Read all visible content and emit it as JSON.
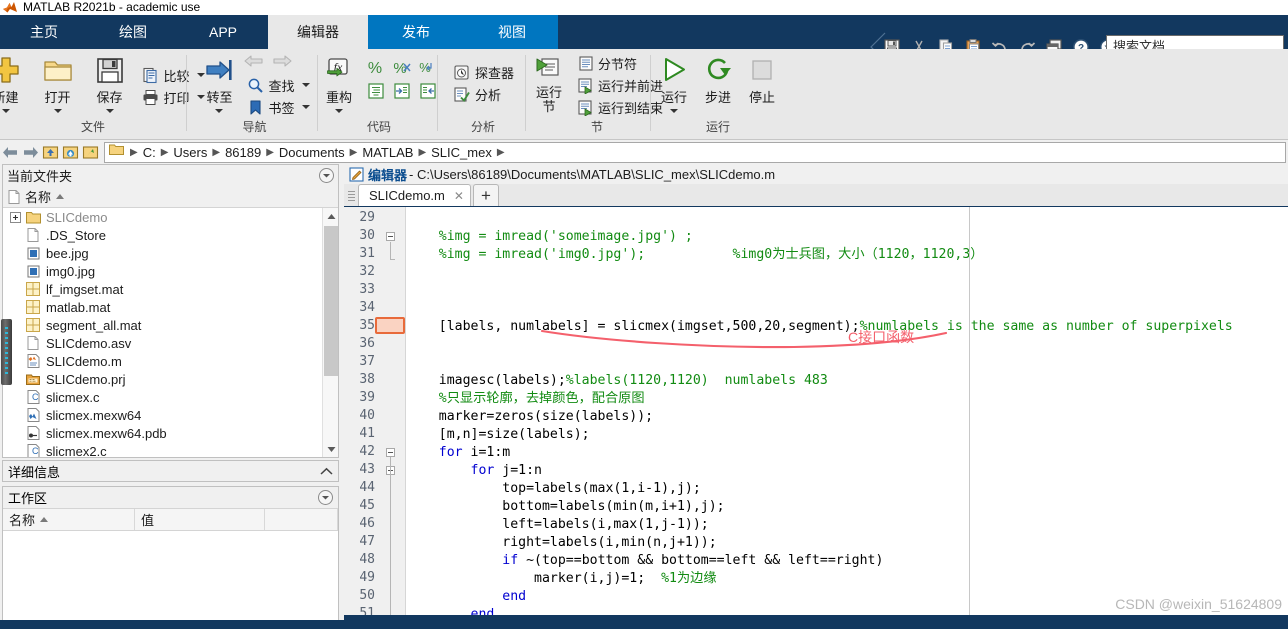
{
  "window": {
    "title": "MATLAB R2021b - academic use",
    "icon": "matlab-logo-icon"
  },
  "ribbon_tabs": [
    {
      "label": "主页",
      "active": false
    },
    {
      "label": "绘图",
      "active": false
    },
    {
      "label": "APP",
      "active": false
    },
    {
      "label": "编辑器",
      "active": true
    },
    {
      "label": "发布",
      "active": false
    },
    {
      "label": "视图",
      "active": false
    }
  ],
  "quick_access": {
    "buttons": [
      {
        "name": "save-icon",
        "label": "保存"
      },
      {
        "name": "cut-icon",
        "label": "剪切"
      },
      {
        "name": "copy-icon",
        "label": "复制"
      },
      {
        "name": "paste-icon",
        "label": "粘贴"
      },
      {
        "name": "undo-icon",
        "label": "撤销"
      },
      {
        "name": "redo-icon",
        "label": "重做"
      },
      {
        "name": "layout-icon",
        "label": "布局"
      },
      {
        "name": "help-icon",
        "label": "帮助"
      },
      {
        "name": "more-icon",
        "label": "更多"
      }
    ],
    "search_placeholder": "搜索文档"
  },
  "ribbon_groups": [
    {
      "label": "文件",
      "big_buttons": [
        {
          "label": "新建",
          "icon": "new-plus-icon",
          "has_caret": true
        },
        {
          "label": "打开",
          "icon": "open-folder-icon",
          "has_caret": true
        },
        {
          "label": "保存",
          "icon": "save-disk-icon",
          "has_caret": true
        }
      ],
      "small_buttons": [
        {
          "label": "比较",
          "icon": "compare-icon",
          "has_caret": true
        },
        {
          "label": "打印",
          "icon": "print-icon",
          "has_caret": true
        }
      ]
    },
    {
      "label": "导航",
      "big_buttons": [
        {
          "label": "转至",
          "icon": "goto-arrow-icon",
          "has_caret": true
        }
      ],
      "small_buttons": [
        {
          "label": "查找",
          "icon": "find-magnifier-icon",
          "has_caret": true
        },
        {
          "label": "书签",
          "icon": "bookmark-icon",
          "has_caret": true
        }
      ],
      "arrow_buttons": [
        {
          "name": "back-arrow-icon"
        },
        {
          "name": "forward-arrow-icon"
        }
      ]
    },
    {
      "label": "代码",
      "big_buttons": [
        {
          "label": "重构",
          "icon": "refactor-fx-icon",
          "has_caret": true
        }
      ],
      "icon_rows": [
        [
          {
            "name": "comment-percent-icon"
          },
          {
            "name": "uncomment-percent-icon"
          },
          {
            "name": "wrap-comment-icon"
          }
        ],
        [
          {
            "name": "smart-indent-icon"
          },
          {
            "name": "indent-right-icon"
          },
          {
            "name": "indent-left-icon"
          }
        ]
      ]
    },
    {
      "label": "分析",
      "small_buttons": [
        {
          "label": "探查器",
          "icon": "profiler-clock-icon",
          "has_caret": false
        },
        {
          "label": "分析",
          "icon": "analyze-check-icon",
          "has_caret": false
        }
      ]
    },
    {
      "label": "节",
      "big_buttons": [
        {
          "label1": "运行",
          "label2": "节",
          "icon": "run-section-icon",
          "has_caret": false
        }
      ],
      "small_buttons": [
        {
          "label": "分节符",
          "icon": "section-break-icon",
          "has_caret": false
        },
        {
          "label": "运行并前进",
          "icon": "run-advance-icon",
          "has_caret": false
        },
        {
          "label": "运行到结束",
          "icon": "run-to-end-icon",
          "has_caret": false
        }
      ]
    },
    {
      "label": "运行",
      "big_buttons": [
        {
          "label": "运行",
          "icon": "run-play-icon",
          "has_caret": true
        },
        {
          "label": "步进",
          "icon": "step-icon",
          "has_caret": false
        },
        {
          "label": "停止",
          "icon": "stop-icon",
          "has_caret": false
        }
      ]
    }
  ],
  "address_bar": {
    "nav_icons": [
      "back-icon",
      "forward-icon",
      "up-folder-icon",
      "home-folder-icon",
      "browse-folder-icon"
    ],
    "folder_icon": "folder-icon",
    "crumbs": [
      "C:",
      "Users",
      "86189",
      "Documents",
      "MATLAB",
      "SLIC_mex"
    ]
  },
  "current_folder": {
    "header": "当前文件夹",
    "column_header": "名称",
    "files": [
      {
        "name": "SLICdemo",
        "icon": "folder-icon",
        "expandable": true,
        "dim": true
      },
      {
        "name": ".DS_Store",
        "icon": "blank-file-icon",
        "expandable": false,
        "dim": false
      },
      {
        "name": "bee.jpg",
        "icon": "image-file-icon",
        "expandable": false,
        "dim": false
      },
      {
        "name": "img0.jpg",
        "icon": "image-file-icon",
        "expandable": false,
        "dim": false
      },
      {
        "name": "lf_imgset.mat",
        "icon": "mat-file-icon",
        "expandable": false,
        "dim": false
      },
      {
        "name": "matlab.mat",
        "icon": "mat-file-icon",
        "expandable": false,
        "dim": false
      },
      {
        "name": "segment_all.mat",
        "icon": "mat-file-icon",
        "expandable": false,
        "dim": false
      },
      {
        "name": "SLICdemo.asv",
        "icon": "blank-file-icon",
        "expandable": false,
        "dim": false
      },
      {
        "name": "SLICdemo.m",
        "icon": "m-file-icon",
        "expandable": false,
        "dim": false
      },
      {
        "name": "SLICdemo.prj",
        "icon": "prj-file-icon",
        "expandable": false,
        "dim": false
      },
      {
        "name": "slicmex.c",
        "icon": "c-file-icon",
        "expandable": false,
        "dim": false
      },
      {
        "name": "slicmex.mexw64",
        "icon": "mex-file-icon",
        "expandable": false,
        "dim": false
      },
      {
        "name": "slicmex.mexw64.pdb",
        "icon": "pdb-file-icon",
        "expandable": false,
        "dim": false
      },
      {
        "name": "slicmex2.c",
        "icon": "c-file-icon",
        "expandable": false,
        "dim": false
      }
    ]
  },
  "details_panel": {
    "header": "详细信息"
  },
  "workspace": {
    "header": "工作区",
    "columns": [
      "名称",
      "值"
    ]
  },
  "editor": {
    "title_prefix": "编辑器",
    "title_dash": " - ",
    "title_path": "C:\\Users\\86189\\Documents\\MATLAB\\SLIC_mex\\SLICdemo.m",
    "tabs": [
      {
        "label": "SLICdemo.m",
        "close": "✕"
      }
    ],
    "new_tab": "+",
    "breakpoint_line": 35,
    "lines": [
      {
        "no": 29,
        "tokens": []
      },
      {
        "no": 30,
        "fold": "open",
        "tokens": [
          {
            "t": "    ",
            "c": "p"
          },
          {
            "t": "%img = imread('someimage.jpg') ;",
            "c": "c"
          }
        ]
      },
      {
        "no": 31,
        "fold": "tail",
        "tokens": [
          {
            "t": "    ",
            "c": "p"
          },
          {
            "t": "%img = imread('img0.jpg');           %img0为士兵图，大小（1120，1120,3）",
            "c": "c"
          }
        ]
      },
      {
        "no": 32,
        "tokens": []
      },
      {
        "no": 33,
        "tokens": []
      },
      {
        "no": 34,
        "tokens": []
      },
      {
        "no": 35,
        "tokens": [
          {
            "t": "    [labels, numlabels] = slicmex(imgset,500,20,segment);",
            "c": "p"
          },
          {
            "t": "%numlabels is the same as number of superpixels",
            "c": "c"
          }
        ]
      },
      {
        "no": 36,
        "tokens": []
      },
      {
        "no": 37,
        "tokens": []
      },
      {
        "no": 38,
        "tokens": [
          {
            "t": "    imagesc(labels);",
            "c": "p"
          },
          {
            "t": "%labels(1120,1120)  numlabels 483",
            "c": "c"
          }
        ]
      },
      {
        "no": 39,
        "tokens": [
          {
            "t": "    ",
            "c": "p"
          },
          {
            "t": "%只显示轮廓，去掉颜色，配合原图",
            "c": "c"
          }
        ]
      },
      {
        "no": 40,
        "tokens": [
          {
            "t": "    marker=zeros(size(labels));",
            "c": "p"
          }
        ]
      },
      {
        "no": 41,
        "tokens": [
          {
            "t": "    [m,n]=size(labels);",
            "c": "p"
          }
        ]
      },
      {
        "no": 42,
        "fold": "open",
        "tokens": [
          {
            "t": "    ",
            "c": "p"
          },
          {
            "t": "for",
            "c": "k"
          },
          {
            "t": " i=1:m",
            "c": "p"
          }
        ]
      },
      {
        "no": 43,
        "fold": "open",
        "tokens": [
          {
            "t": "        ",
            "c": "p"
          },
          {
            "t": "for",
            "c": "k"
          },
          {
            "t": " j=1:n",
            "c": "p"
          }
        ]
      },
      {
        "no": 44,
        "tokens": [
          {
            "t": "            top=labels(max(1,i-1),j);",
            "c": "p"
          }
        ]
      },
      {
        "no": 45,
        "tokens": [
          {
            "t": "            bottom=labels(min(m,i+1),j);",
            "c": "p"
          }
        ]
      },
      {
        "no": 46,
        "tokens": [
          {
            "t": "            left=labels(i,max(1,j-1));",
            "c": "p"
          }
        ]
      },
      {
        "no": 47,
        "tokens": [
          {
            "t": "            right=labels(i,min(n,j+1));",
            "c": "p"
          }
        ]
      },
      {
        "no": 48,
        "tokens": [
          {
            "t": "            ",
            "c": "p"
          },
          {
            "t": "if",
            "c": "k"
          },
          {
            "t": " ~(top==bottom && bottom==left && left==right)",
            "c": "p"
          }
        ]
      },
      {
        "no": 49,
        "tokens": [
          {
            "t": "                marker(i,j)=1;  ",
            "c": "p"
          },
          {
            "t": "%1为边缘",
            "c": "c"
          }
        ]
      },
      {
        "no": 50,
        "tokens": [
          {
            "t": "            ",
            "c": "p"
          },
          {
            "t": "end",
            "c": "k"
          }
        ]
      },
      {
        "no": 51,
        "fold": "tail",
        "tokens": [
          {
            "t": "        ",
            "c": "p"
          },
          {
            "t": "end",
            "c": "k"
          }
        ]
      }
    ],
    "annotation": {
      "text": "C接口函数",
      "color": "#f4606c"
    }
  },
  "watermark": "CSDN @weixin_51624809",
  "colors": {
    "titlebar_navy": "#12385f",
    "tab_blue": "#0076c0",
    "ribbon_bg": "#e8e8e8",
    "keyword_blue": "#0000d0",
    "comment_green": "#128b12",
    "annotation_red": "#f4606c"
  }
}
